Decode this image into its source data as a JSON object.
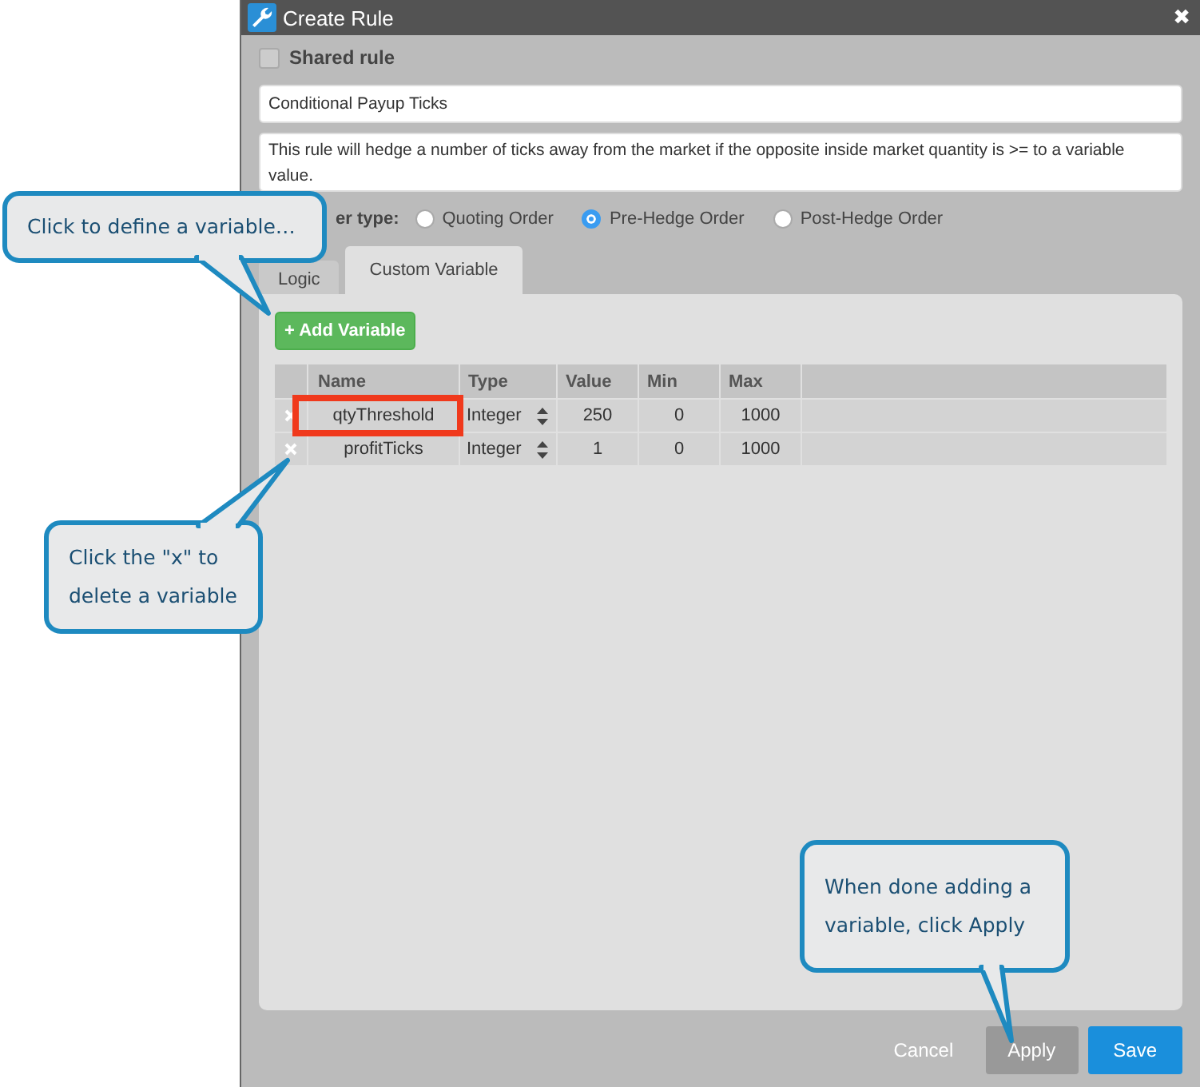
{
  "window": {
    "title": "Create Rule",
    "close": "✖"
  },
  "shared_rule": {
    "label": "Shared rule",
    "checked": false
  },
  "rule_name": {
    "value": "Conditional Payup Ticks"
  },
  "description": {
    "value": "This rule will hedge a number of ticks away from the market if the opposite inside market quantity is >= to a variable value."
  },
  "order_type": {
    "label": "er type:",
    "options": [
      {
        "label": "Quoting Order",
        "selected": false
      },
      {
        "label": "Pre-Hedge Order",
        "selected": true
      },
      {
        "label": "Post-Hedge Order",
        "selected": false
      }
    ]
  },
  "tabs": [
    {
      "label": "Logic",
      "selected": false
    },
    {
      "label": "Custom Variable",
      "selected": true
    }
  ],
  "add_button": "+ Add Variable",
  "table": {
    "columns": [
      "Name",
      "Type",
      "Value",
      "Min",
      "Max"
    ],
    "rows": [
      {
        "name": "qtyThreshold",
        "type": "Integer",
        "value": "250",
        "min": "0",
        "max": "1000",
        "highlighted": true
      },
      {
        "name": "profitTicks",
        "type": "Integer",
        "value": "1",
        "min": "0",
        "max": "1000",
        "highlighted": false
      }
    ]
  },
  "buttons": [
    {
      "label": "Cancel",
      "kind": "link"
    },
    {
      "label": "Apply",
      "kind": "secondary"
    },
    {
      "label": "Save",
      "kind": "primary"
    }
  ],
  "callouts": [
    {
      "text": "Click to define a variable…"
    },
    {
      "text": "Click the \"x\" to delete a variable"
    },
    {
      "text": "When done adding a variable, click Apply"
    }
  ]
}
